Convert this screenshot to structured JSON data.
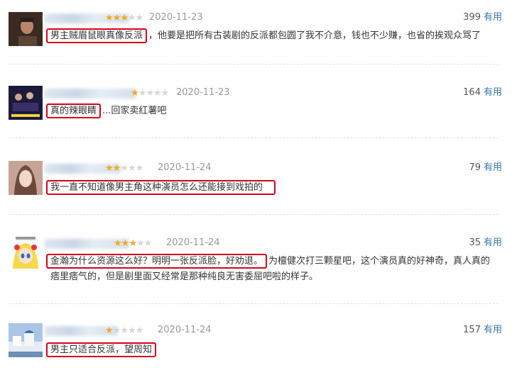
{
  "reviews": [
    {
      "stars": 3,
      "date": "2020-11-23",
      "useful_count": "399",
      "useful_label": "有用",
      "highlight": "男主贼眉鼠眼真像反派",
      "rest": "，他要是把所有古装剧的反派都包圆了我不介意，钱也不少赚，也省的挨观众骂了"
    },
    {
      "stars": 1,
      "date": "2020-11-23",
      "useful_count": "164",
      "useful_label": "有用",
      "highlight": "真的辣眼睛",
      "rest": "...回家卖红薯吧"
    },
    {
      "stars": 2,
      "date": "2020-11-24",
      "useful_count": "79",
      "useful_label": "有用",
      "highlight": "我一直不知道像男主角这种演员怎么还能接到戏拍的",
      "rest": ""
    },
    {
      "stars": 3,
      "date": "2020-11-24",
      "useful_count": "35",
      "useful_label": "有用",
      "highlight": "金瀚为什么资源这么好？明明一张反派脸，好劝退。",
      "rest": "为檀健次打三颗星吧，这个演员真的好神奇，真人真的痞里痞气的，但是剧里面又经常是那种纯良无害委屈吧啦的样子。"
    },
    {
      "stars": 1,
      "date": "2020-11-24",
      "useful_count": "157",
      "useful_label": "有用",
      "highlight": "男主只适合反派，望周知",
      "rest": ""
    }
  ],
  "colors": {
    "star": "#f5a623",
    "highlight_border": "#d8001e",
    "useful_label": "#3377aa",
    "date": "#999999"
  }
}
